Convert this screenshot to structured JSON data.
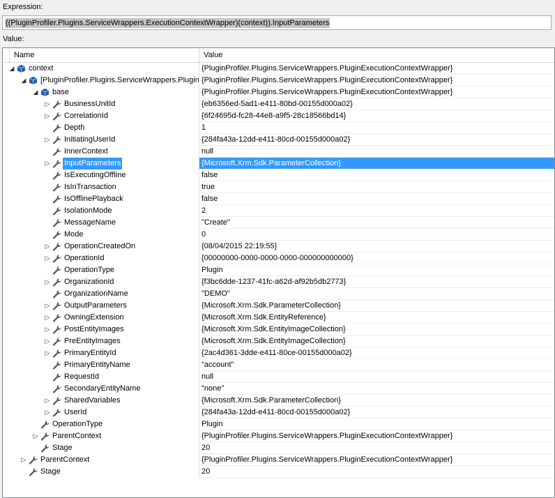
{
  "expression": {
    "label": "Expression:",
    "value": "((PluginProfiler.Plugins.ServiceWrappers.ExecutionContextWrapper)(context)).InputParameters"
  },
  "value_label": "Value:",
  "columns": {
    "name": "Name",
    "value": "Value"
  },
  "rows": [
    {
      "depth": 0,
      "expander": "expanded",
      "icon": "cube",
      "name": "context",
      "value": "{PluginProfiler.Plugins.ServiceWrappers.PluginExecutionContextWrapper}"
    },
    {
      "depth": 1,
      "expander": "expanded",
      "icon": "cube",
      "name": "[PluginProfiler.Plugins.ServiceWrappers.PluginExecutionContextWrapper]",
      "value": "{PluginProfiler.Plugins.ServiceWrappers.PluginExecutionContextWrapper}"
    },
    {
      "depth": 2,
      "expander": "expanded",
      "icon": "cube",
      "name": "base",
      "value": "{PluginProfiler.Plugins.ServiceWrappers.PluginExecutionContextWrapper}"
    },
    {
      "depth": 3,
      "expander": "collapsed",
      "icon": "wrench",
      "name": "BusinessUnitId",
      "value": "{eb6356ed-5ad1-e411-80bd-00155d000a02}"
    },
    {
      "depth": 3,
      "expander": "collapsed",
      "icon": "wrench",
      "name": "CorrelationId",
      "value": "{6f24695d-fc28-44e8-a9f5-28c18566bd14}"
    },
    {
      "depth": 3,
      "expander": "none",
      "icon": "wrench",
      "name": "Depth",
      "value": "1"
    },
    {
      "depth": 3,
      "expander": "collapsed",
      "icon": "wrench",
      "name": "InitiatingUserId",
      "value": "{284fa43a-12dd-e411-80cd-00155d000a02}"
    },
    {
      "depth": 3,
      "expander": "none",
      "icon": "wrench",
      "name": "InnerContext",
      "value": "null"
    },
    {
      "depth": 3,
      "expander": "collapsed",
      "icon": "wrench",
      "name": "InputParameters",
      "value": "{Microsoft.Xrm.Sdk.ParameterCollection}",
      "selected": true
    },
    {
      "depth": 3,
      "expander": "none",
      "icon": "wrench",
      "name": "IsExecutingOffline",
      "value": "false"
    },
    {
      "depth": 3,
      "expander": "none",
      "icon": "wrench",
      "name": "IsInTransaction",
      "value": "true"
    },
    {
      "depth": 3,
      "expander": "none",
      "icon": "wrench",
      "name": "IsOfflinePlayback",
      "value": "false"
    },
    {
      "depth": 3,
      "expander": "none",
      "icon": "wrench",
      "name": "IsolationMode",
      "value": "2"
    },
    {
      "depth": 3,
      "expander": "none",
      "icon": "wrench",
      "name": "MessageName",
      "value": "\"Create\""
    },
    {
      "depth": 3,
      "expander": "none",
      "icon": "wrench",
      "name": "Mode",
      "value": "0"
    },
    {
      "depth": 3,
      "expander": "collapsed",
      "icon": "wrench",
      "name": "OperationCreatedOn",
      "value": "{08/04/2015 22:19:55}"
    },
    {
      "depth": 3,
      "expander": "collapsed",
      "icon": "wrench",
      "name": "OperationId",
      "value": "{00000000-0000-0000-0000-000000000000}"
    },
    {
      "depth": 3,
      "expander": "none",
      "icon": "wrench",
      "name": "OperationType",
      "value": "Plugin"
    },
    {
      "depth": 3,
      "expander": "collapsed",
      "icon": "wrench",
      "name": "OrganizationId",
      "value": "{f3bc6dde-1237-41fc-a62d-af92b5db2773}"
    },
    {
      "depth": 3,
      "expander": "none",
      "icon": "wrench",
      "name": "OrganizationName",
      "value": "\"DEMO\""
    },
    {
      "depth": 3,
      "expander": "collapsed",
      "icon": "wrench",
      "name": "OutputParameters",
      "value": "{Microsoft.Xrm.Sdk.ParameterCollection}"
    },
    {
      "depth": 3,
      "expander": "collapsed",
      "icon": "wrench",
      "name": "OwningExtension",
      "value": "{Microsoft.Xrm.Sdk.EntityReference}"
    },
    {
      "depth": 3,
      "expander": "collapsed",
      "icon": "wrench",
      "name": "PostEntityImages",
      "value": "{Microsoft.Xrm.Sdk.EntityImageCollection}"
    },
    {
      "depth": 3,
      "expander": "collapsed",
      "icon": "wrench",
      "name": "PreEntityImages",
      "value": "{Microsoft.Xrm.Sdk.EntityImageCollection}"
    },
    {
      "depth": 3,
      "expander": "collapsed",
      "icon": "wrench",
      "name": "PrimaryEntityId",
      "value": "{2ac4d361-3dde-e411-80ce-00155d000a02}"
    },
    {
      "depth": 3,
      "expander": "none",
      "icon": "wrench",
      "name": "PrimaryEntityName",
      "value": "\"account\""
    },
    {
      "depth": 3,
      "expander": "none",
      "icon": "wrench",
      "name": "RequestId",
      "value": "null"
    },
    {
      "depth": 3,
      "expander": "none",
      "icon": "wrench",
      "name": "SecondaryEntityName",
      "value": "\"none\""
    },
    {
      "depth": 3,
      "expander": "collapsed",
      "icon": "wrench",
      "name": "SharedVariables",
      "value": "{Microsoft.Xrm.Sdk.ParameterCollection}"
    },
    {
      "depth": 3,
      "expander": "collapsed",
      "icon": "wrench",
      "name": "UserId",
      "value": "{284fa43a-12dd-e411-80cd-00155d000a02}"
    },
    {
      "depth": 2,
      "expander": "none",
      "icon": "wrench",
      "name": "OperationType",
      "value": "Plugin"
    },
    {
      "depth": 2,
      "expander": "collapsed",
      "icon": "wrench",
      "name": "ParentContext",
      "value": "{PluginProfiler.Plugins.ServiceWrappers.PluginExecutionContextWrapper}"
    },
    {
      "depth": 2,
      "expander": "none",
      "icon": "wrench",
      "name": "Stage",
      "value": "20"
    },
    {
      "depth": 1,
      "expander": "collapsed",
      "icon": "wrench",
      "name": "ParentContext",
      "value": "{PluginProfiler.Plugins.ServiceWrappers.PluginExecutionContextWrapper}"
    },
    {
      "depth": 1,
      "expander": "none",
      "icon": "wrench",
      "name": "Stage",
      "value": "20"
    }
  ],
  "colors": {
    "selection": "#3399ff",
    "cube_icon": "#1e5fa8",
    "wrench_icon": "#555555"
  }
}
